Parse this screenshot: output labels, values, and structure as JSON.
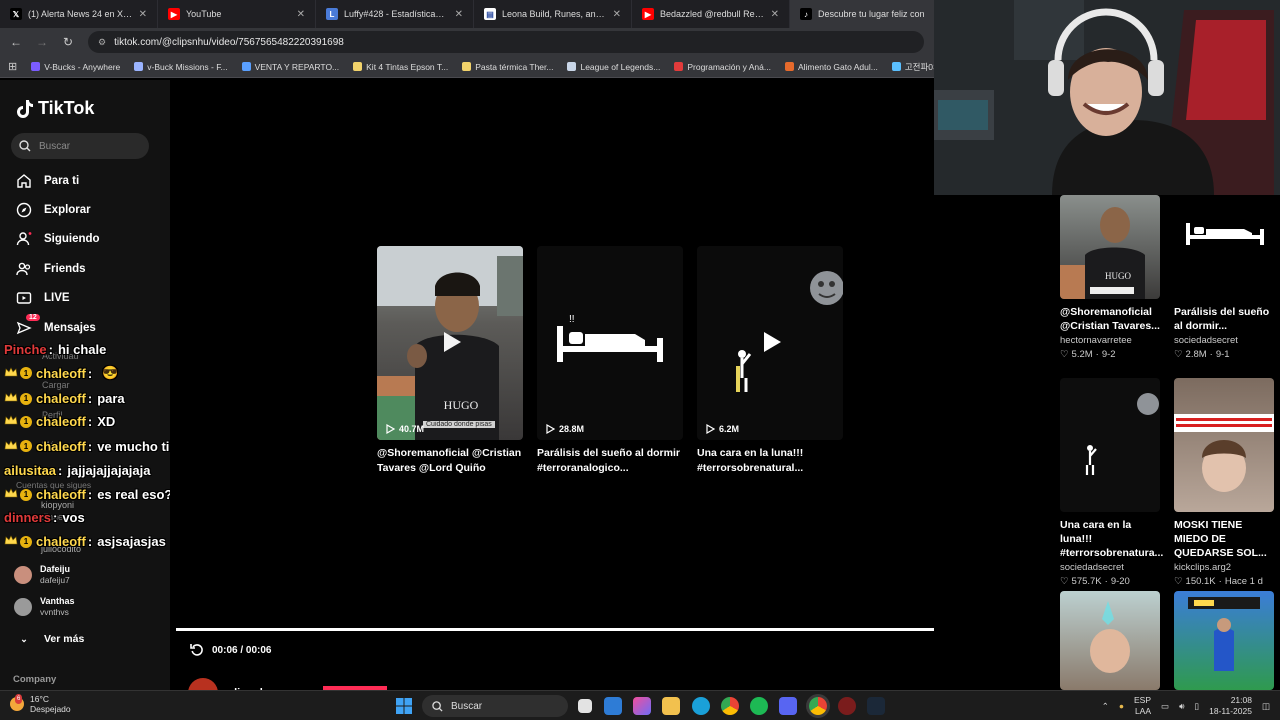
{
  "browser": {
    "tabs": [
      {
        "label": "(1) Alerta News 24 en X: \"saus",
        "icon": "x-logo-icon",
        "color": "#000000",
        "glyph": "𝕏"
      },
      {
        "label": "YouTube",
        "icon": "youtube-icon",
        "color": "#ff0000",
        "glyph": "▶"
      },
      {
        "label": "Luffy#428 - Estadísticas del inv",
        "icon": "stats-icon",
        "color": "#4a7bd8",
        "glyph": "L"
      },
      {
        "label": "Leona Build, Runes, and Items",
        "icon": "guide-icon",
        "color": "#ffffff",
        "glyph": "▤"
      },
      {
        "label": "Bedazzled @redbull Restoc",
        "icon": "youtube-icon",
        "color": "#ff0000",
        "glyph": "▶"
      },
      {
        "label": "Descubre tu lugar feliz con",
        "icon": "tiktok-icon",
        "color": "#000000",
        "glyph": "♪"
      }
    ],
    "url": "tiktok.com/@clipsnhu/video/7567565482220391698",
    "bookmarks": [
      {
        "label": "V-Bucks - Anywhere",
        "color": "#7b5cff"
      },
      {
        "label": "v-Buck Missions - F...",
        "color": "#9bb4ff"
      },
      {
        "label": "VENTA Y REPARTO...",
        "color": "#5aa0ff"
      },
      {
        "label": "Kit 4 Tintas Epson T...",
        "color": "#f2d36b"
      },
      {
        "label": "Pasta térmica Ther...",
        "color": "#f2d36b"
      },
      {
        "label": "League of Legends...",
        "color": "#c9d6e8"
      },
      {
        "label": "Programación y Aná...",
        "color": "#e23b3b"
      },
      {
        "label": "Alimento Gato Adul...",
        "color": "#e66a2c"
      },
      {
        "label": "고전파0의 방송국",
        "color": "#5bc0ff"
      }
    ]
  },
  "sidebar": {
    "brand": "TikTok",
    "search_placeholder": "Buscar",
    "items": [
      {
        "label": "Para ti",
        "icon": "home-icon"
      },
      {
        "label": "Explorar",
        "icon": "compass-icon"
      },
      {
        "label": "Siguiendo",
        "icon": "user-follow-icon"
      },
      {
        "label": "Friends",
        "icon": "friends-icon"
      },
      {
        "label": "LIVE",
        "icon": "live-icon"
      },
      {
        "label": "Mensajes",
        "icon": "messages-icon",
        "badge": "12"
      }
    ],
    "faded": [
      "Actividad",
      "Cargar",
      "Perfil",
      "Más"
    ],
    "following_title": "Cuentas que sigues",
    "following": [
      {
        "name": "kiopyoni",
        "handle": ""
      },
      {
        "name": "dinners",
        "handle": ""
      },
      {
        "name": "juliocodito",
        "handle": "juliocodito"
      },
      {
        "name": "Dafeiju",
        "handle": "dafeiju7"
      },
      {
        "name": "Vanthas",
        "handle": "vvnthvs"
      }
    ],
    "see_more": "Ver más",
    "company": "Company"
  },
  "chat": [
    {
      "user": "Pinche",
      "msg": "hi chale",
      "badge": false,
      "color": "#e03a3a"
    },
    {
      "user": "chaleoff",
      "msg": "",
      "badge": true,
      "emote": "😎",
      "color": "#ffd84d"
    },
    {
      "user": "chaleoff",
      "msg": "para",
      "badge": true,
      "color": "#ffd84d"
    },
    {
      "user": "chaleoff",
      "msg": "XD",
      "badge": true,
      "color": "#ffd84d"
    },
    {
      "user": "chaleoff",
      "msg": "ve mucho tiktok",
      "badge": true,
      "emote": "🧃",
      "color": "#ffd84d"
    },
    {
      "user": "ailusitaa",
      "msg": "jajjajajjajajaja",
      "badge": false,
      "color": "#ffd84d"
    },
    {
      "user": "chaleoff",
      "msg": "es real eso?",
      "badge": true,
      "color": "#ffd84d"
    },
    {
      "user": "dinners",
      "msg": "vos",
      "badge": false,
      "color": "#e03a3a"
    },
    {
      "user": "chaleoff",
      "msg": "asjsajasjas",
      "badge": true,
      "color": "#ffd84d"
    }
  ],
  "player": {
    "cards": [
      {
        "title": "@Shoremanoficial @Cristian Tavares @Lord Quiño",
        "views": "40.7M",
        "caption": "Cuidado donde pisas"
      },
      {
        "title": "Parálisis del sueño al dormir #terroranalogico...",
        "views": "28.8M"
      },
      {
        "title": "Una cara en la luna!!! #terrorsobrenatural...",
        "views": "6.2M"
      }
    ],
    "time": "00:06 / 00:06",
    "author": "clipsnhu",
    "progress": 1.0
  },
  "recommended": [
    {
      "title": "@Shoremanoficial @Cristian Tavares...",
      "user": "hectornavarretee",
      "likes": "5.2M",
      "date": "9-2"
    },
    {
      "title": "Parálisis del sueño al dormir...",
      "user": "sociedadsecret",
      "likes": "2.8M",
      "date": "9-1"
    },
    {
      "title": "Una cara en la luna!!! #terrorsobrenatura...",
      "user": "sociedadsecret",
      "likes": "575.7K",
      "date": "9-20"
    },
    {
      "title": "MOSKI TIENE MIEDO DE QUEDARSE SOL...",
      "user": "kickclips.arg2",
      "likes": "150.1K",
      "date": "Hace 1 d"
    }
  ],
  "taskbar": {
    "temp": "16°C",
    "weather": "Despejado",
    "weather_badge": "6",
    "search": "Buscar",
    "lang": "ESP",
    "lang2": "LAA",
    "time": "21:08",
    "date": "18-11-2025"
  },
  "colors": {
    "accent": "#fe2c55",
    "sidebar_bg": "#121212",
    "chrome_bg": "#35363a"
  }
}
